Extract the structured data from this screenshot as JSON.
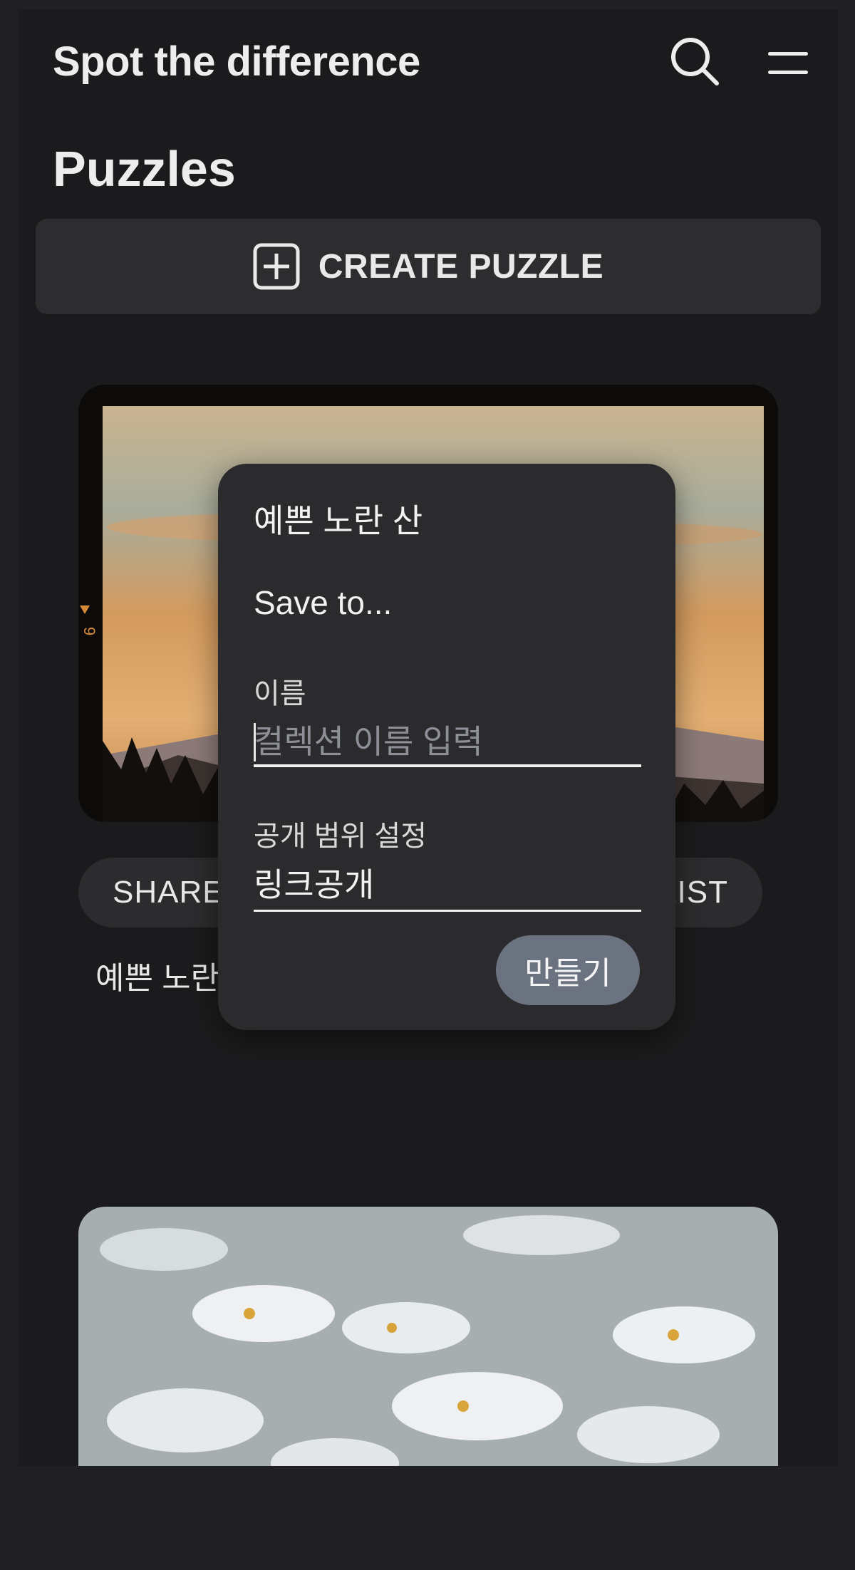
{
  "header": {
    "title": "Spot the difference",
    "search_icon": "search-icon",
    "menu_icon": "menu-icon"
  },
  "section": {
    "title": "Puzzles"
  },
  "create_button": {
    "label": "CREATE PUZZLE",
    "icon": "plus-square-icon"
  },
  "card": {
    "actions": [
      "SHARE",
      "LIST"
    ],
    "caption": "예쁜 노란 산"
  },
  "dialog": {
    "title": "예쁜 노란 산",
    "save_to": "Save to...",
    "name_label": "이름",
    "name_placeholder": "컬렉션 이름 입력",
    "name_value": "",
    "visibility_label": "공개 범위 설정",
    "visibility_value": "링크공개",
    "create_label": "만들기"
  },
  "colors": {
    "dialog_bg": "#2b2b2d",
    "confirm_button": "#6b7280",
    "page_bg": "#1b1b1d"
  }
}
